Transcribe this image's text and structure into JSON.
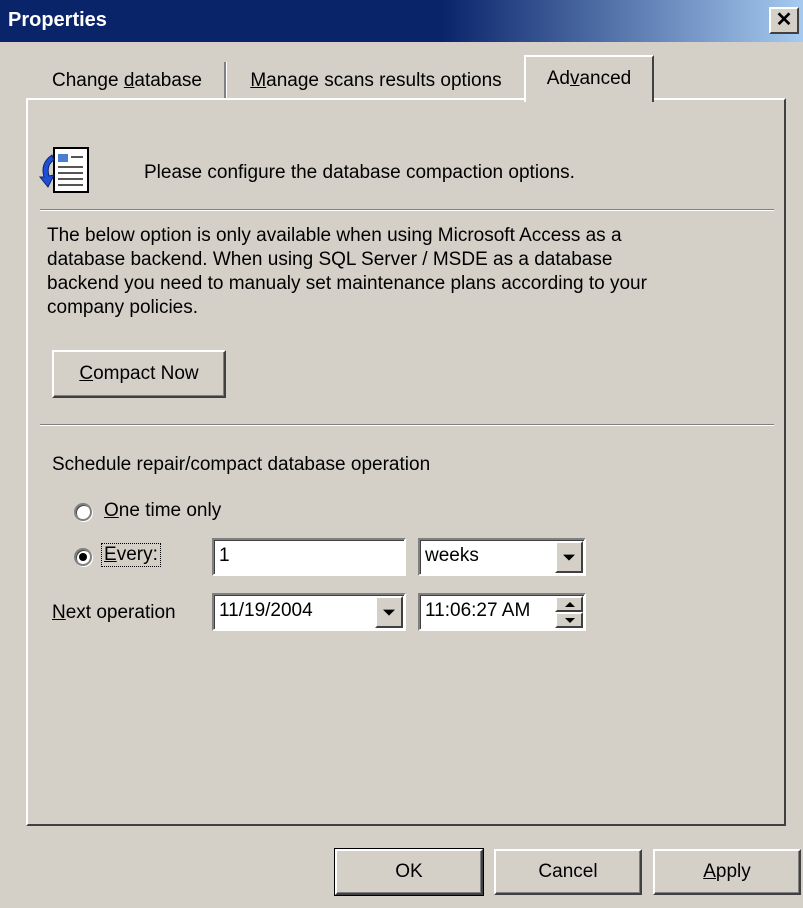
{
  "window": {
    "title": "Properties",
    "close_glyph": "✕"
  },
  "tabs": [
    {
      "pre": "Change ",
      "accel": "d",
      "post": "atabase"
    },
    {
      "pre": "",
      "accel": "M",
      "post": "anage scans results options"
    },
    {
      "pre": "Ad",
      "accel": "v",
      "post": "anced"
    }
  ],
  "header": {
    "text": "Please configure the database compaction options.",
    "icon": "database-document-icon"
  },
  "info_lines": [
    "The below option is only available when using Microsoft Access as a",
    "database backend. When using SQL Server / MSDE as a database",
    "backend you need to manualy set maintenance plans according to your",
    "company policies."
  ],
  "compact_button": {
    "accel": "C",
    "post": "ompact Now"
  },
  "schedule": {
    "label": "Schedule repair/compact database operation",
    "one_time": {
      "accel": "O",
      "post": "ne time only",
      "selected": false
    },
    "every": {
      "accel": "E",
      "post": "very:",
      "selected": true
    },
    "interval_value": "1",
    "interval_unit": "weeks",
    "next_label_accel": "N",
    "next_label_post": "ext operation",
    "next_date": "11/19/2004",
    "next_time": "11:06:27 AM"
  },
  "footer": {
    "ok": "OK",
    "cancel": "Cancel",
    "apply_accel": "A",
    "apply_post": "pply"
  },
  "colors": {
    "face": "#d4d0c8",
    "title_active": "#0a246a",
    "title_fade": "#a6caf0"
  }
}
